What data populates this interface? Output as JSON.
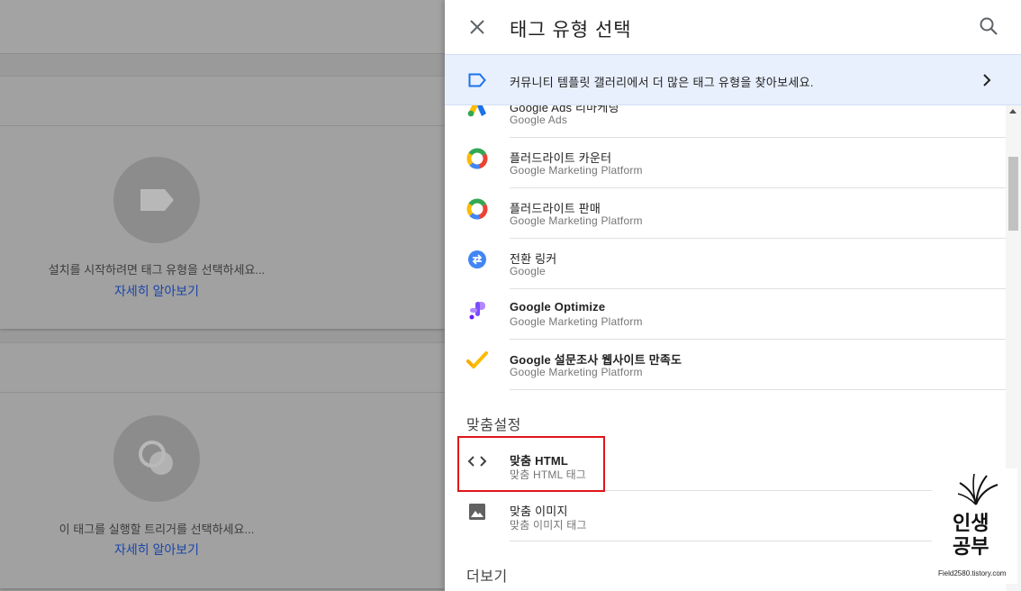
{
  "background": {
    "card1": {
      "message": "설치를 시작하려면 태그 유형을 선택하세요...",
      "link": "자세히 알아보기"
    },
    "card2": {
      "message": "이 태그를 실행할 트리거를 선택하세요...",
      "link": "자세히 알아보기"
    }
  },
  "panel": {
    "title": "태그 유형 선택",
    "banner": "커뮤니티 템플릿 갤러리에서 더 많은 태그 유형을 찾아보세요.",
    "items": [
      {
        "name": "Google Ads 리마케팅",
        "sub": "Google Ads",
        "icon": "google-ads-icon"
      },
      {
        "name": "플러드라이트 카운터",
        "sub": "Google Marketing Platform",
        "icon": "floodlight-icon"
      },
      {
        "name": "플러드라이트 판매",
        "sub": "Google Marketing Platform",
        "icon": "floodlight-icon"
      },
      {
        "name": "전환 링커",
        "sub": "Google",
        "icon": "conversion-linker-icon"
      },
      {
        "name": "Google Optimize",
        "sub": "Google Marketing Platform",
        "icon": "google-optimize-icon"
      },
      {
        "name": "Google 설문조사 웹사이트 만족도",
        "sub": "Google Marketing Platform",
        "icon": "google-surveys-icon"
      }
    ],
    "custom_section": "맞춤설정",
    "custom_items": [
      {
        "name": "맞춤 HTML",
        "sub": "맞춤 HTML 태그",
        "icon": "code-icon"
      },
      {
        "name": "맞춤 이미지",
        "sub": "맞춤 이미지 태그",
        "icon": "image-icon"
      }
    ],
    "more_section": "더보기"
  },
  "watermark": {
    "line1": "인생",
    "line2": "공부",
    "site": "Field2580.tistory.com"
  },
  "colors": {
    "banner_bg": "#e8f0fe",
    "link": "#1a45a8",
    "highlight": "#e0161b"
  }
}
